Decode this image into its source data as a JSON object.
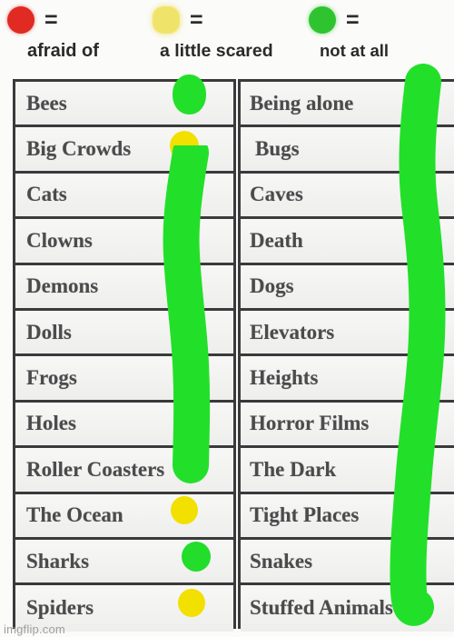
{
  "meme": {
    "watermark": "imgflip.com",
    "colors": {
      "afraid_of": "#e02a22",
      "a_little_scared": "#f0e36a",
      "not_at_all": "#2fc42f",
      "marker_green": "#22e029",
      "marker_yellow": "#f2e000",
      "marker_bright_green": "#22dd2a",
      "grid_line": "#3a3a3c",
      "paper": "#f4f4f3",
      "text": "#4b4b4d"
    }
  },
  "legend": {
    "equals_sign": "=",
    "items": [
      {
        "id": "afraid-of",
        "label": "afraid of",
        "color": "#e02a22",
        "shape": "circle"
      },
      {
        "id": "a-little-scared",
        "label": "a little scared",
        "color": "#f0e36a",
        "shape": "rounded-square"
      },
      {
        "id": "not-at-all",
        "label": "not at all",
        "color": "#2fc42f",
        "shape": "circle"
      }
    ]
  },
  "table": {
    "left_column": [
      {
        "label": "Bees",
        "answer": "not at all",
        "marker": "green"
      },
      {
        "label": "Big Crowds",
        "answer": "a little scared",
        "marker": "yellow"
      },
      {
        "label": "Cats",
        "answer": "not at all",
        "marker": "stroke"
      },
      {
        "label": "Clowns",
        "answer": "not at all",
        "marker": "stroke"
      },
      {
        "label": "Demons",
        "answer": "not at all",
        "marker": "stroke"
      },
      {
        "label": "Dolls",
        "answer": "not at all",
        "marker": "stroke"
      },
      {
        "label": "Frogs",
        "answer": "not at all",
        "marker": "stroke"
      },
      {
        "label": "Holes",
        "answer": "not at all",
        "marker": "stroke"
      },
      {
        "label": "Roller Coasters",
        "answer": "not at all",
        "marker": "stroke"
      },
      {
        "label": "The Ocean",
        "answer": "a little scared",
        "marker": "yellow"
      },
      {
        "label": "Sharks",
        "answer": "not at all",
        "marker": "green"
      },
      {
        "label": "Spiders",
        "answer": "a little scared",
        "marker": "yellow"
      }
    ],
    "right_column": [
      {
        "label": "Being alone",
        "answer": "not at all",
        "marker": "stroke"
      },
      {
        "label": "Bugs",
        "answer": "not at all",
        "marker": "stroke"
      },
      {
        "label": "Caves",
        "answer": "not at all",
        "marker": "stroke"
      },
      {
        "label": "Death",
        "answer": "not at all",
        "marker": "stroke"
      },
      {
        "label": "Dogs",
        "answer": "not at all",
        "marker": "stroke"
      },
      {
        "label": "Elevators",
        "answer": "not at all",
        "marker": "stroke"
      },
      {
        "label": "Heights",
        "answer": "not at all",
        "marker": "stroke"
      },
      {
        "label": "Horror Films",
        "answer": "not at all",
        "marker": "stroke"
      },
      {
        "label": "The Dark",
        "answer": "not at all",
        "marker": "stroke"
      },
      {
        "label": "Tight Places",
        "answer": "not at all",
        "marker": "stroke"
      },
      {
        "label": "Snakes",
        "answer": "not at all",
        "marker": "stroke"
      },
      {
        "label": "Stuffed Animals",
        "answer": "not at all",
        "marker": "stroke"
      }
    ]
  }
}
